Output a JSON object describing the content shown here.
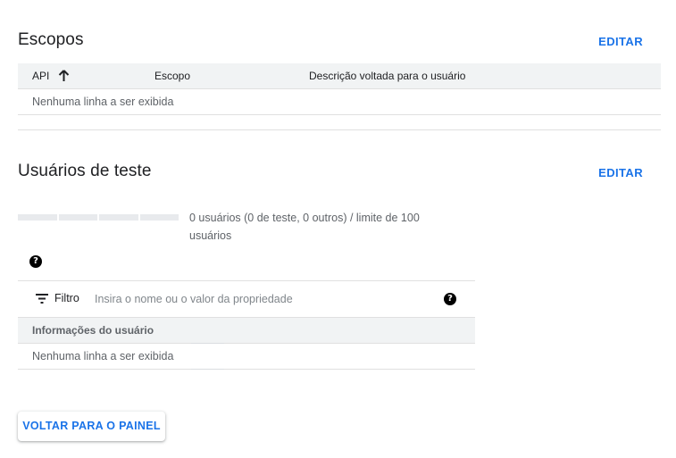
{
  "scopes": {
    "title": "Escopos",
    "edit_label": "EDITAR",
    "columns": [
      "API",
      "Escopo",
      "Descrição voltada para o usuário"
    ],
    "sorted_column": "API",
    "sort_direction": "ascending",
    "empty_text": "Nenhuma linha a ser exibida"
  },
  "test_users": {
    "title": "Usuários de teste",
    "edit_label": "EDITAR",
    "progress_fraction": 0,
    "progress_text": "0 usuários (0 de teste, 0 outros) / limite de 100 usuários",
    "filter": {
      "label": "Filtro",
      "placeholder": "Insira o nome ou o valor da propriedade"
    },
    "columns": [
      "Informações do usuário"
    ],
    "empty_text": "Nenhuma linha a ser exibida"
  },
  "back_button_label": "VOLTAR PARA O PAINEL",
  "colors": {
    "accent": "#1a73e8",
    "header_bg": "#f1f3f4",
    "progress_track": "#e8eaed"
  },
  "icons": [
    "arrow-up-icon",
    "help-icon",
    "filter-icon"
  ]
}
